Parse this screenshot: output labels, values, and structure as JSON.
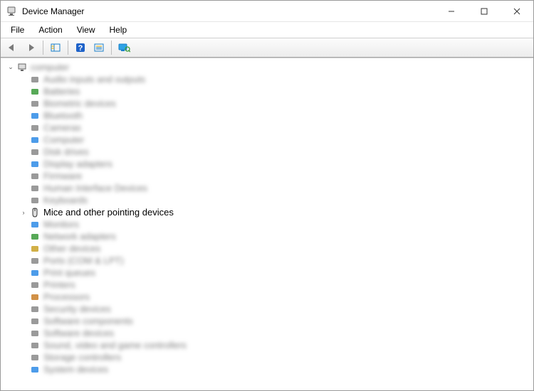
{
  "window": {
    "title": "Device Manager",
    "controls": {
      "min": "–",
      "max": "▢",
      "close": "✕"
    }
  },
  "menu": {
    "file": "File",
    "action": "Action",
    "view": "View",
    "help": "Help"
  },
  "tree": {
    "root_label": "computer",
    "focused_label": "Mice and other pointing devices",
    "items": [
      {
        "label": "Audio inputs and outputs",
        "color": "#888"
      },
      {
        "label": "Batteries",
        "color": "#3a9a3a"
      },
      {
        "label": "Biometric devices",
        "color": "#888"
      },
      {
        "label": "Bluetooth",
        "color": "#2e8be6"
      },
      {
        "label": "Cameras",
        "color": "#888"
      },
      {
        "label": "Computer",
        "color": "#2e8be6"
      },
      {
        "label": "Disk drives",
        "color": "#888"
      },
      {
        "label": "Display adapters",
        "color": "#2e8be6"
      },
      {
        "label": "Firmware",
        "color": "#888"
      },
      {
        "label": "Human Interface Devices",
        "color": "#888"
      },
      {
        "label": "Keyboards",
        "color": "#888"
      },
      {
        "focused": true
      },
      {
        "label": "Monitors",
        "color": "#2e8be6"
      },
      {
        "label": "Network adapters",
        "color": "#3a9a3a"
      },
      {
        "label": "Other devices",
        "color": "#c9a227"
      },
      {
        "label": "Ports (COM & LPT)",
        "color": "#888"
      },
      {
        "label": "Print queues",
        "color": "#2e8be6"
      },
      {
        "label": "Printers",
        "color": "#888"
      },
      {
        "label": "Processors",
        "color": "#c97e27"
      },
      {
        "label": "Security devices",
        "color": "#888"
      },
      {
        "label": "Software components",
        "color": "#888"
      },
      {
        "label": "Software devices",
        "color": "#888"
      },
      {
        "label": "Sound, video and game controllers",
        "color": "#888"
      },
      {
        "label": "Storage controllers",
        "color": "#888"
      },
      {
        "label": "System devices",
        "color": "#2e8be6"
      }
    ]
  }
}
